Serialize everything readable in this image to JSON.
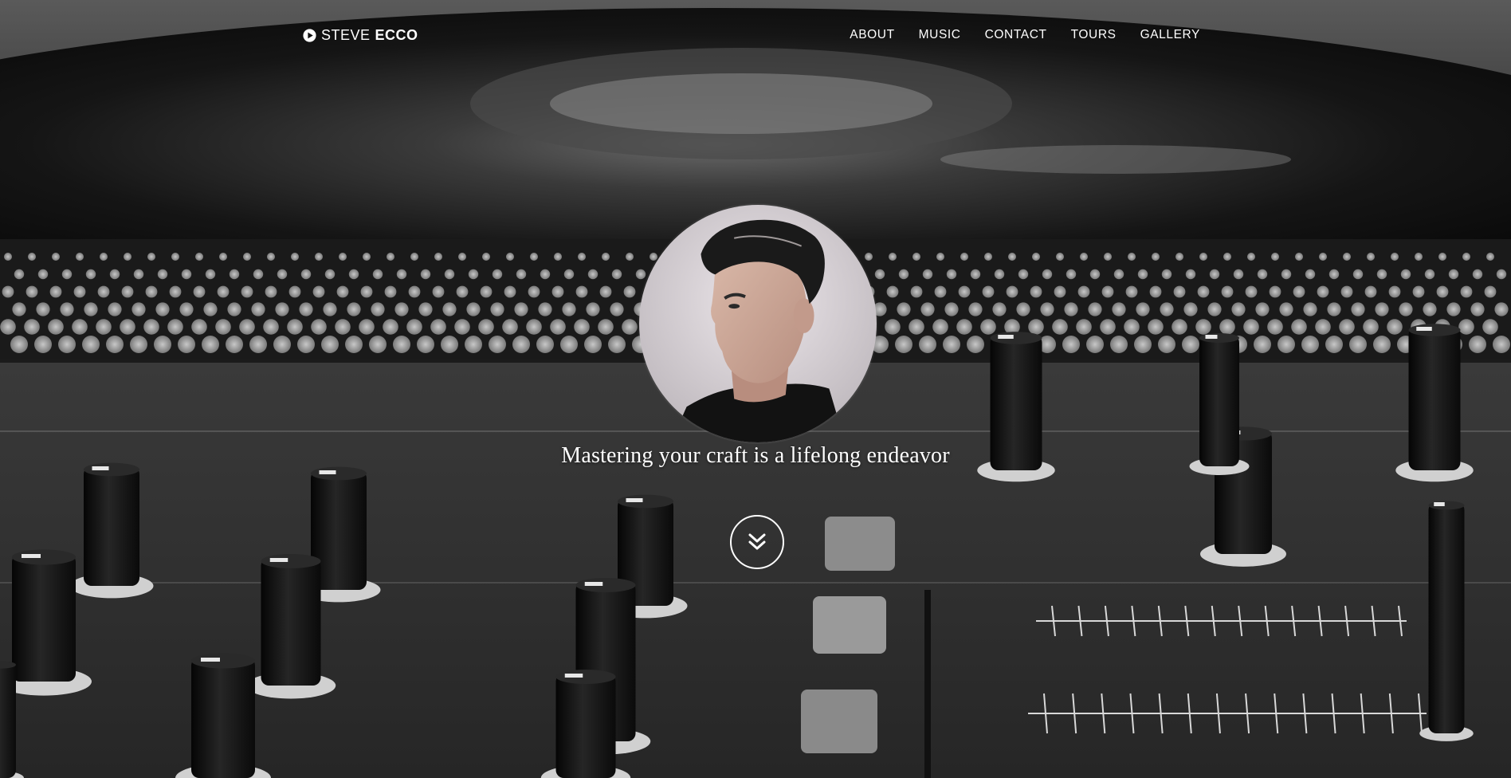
{
  "brand": {
    "first": "STEVE",
    "last": "ECCO",
    "icon": "play-circle-icon"
  },
  "nav": {
    "items": [
      {
        "label": "ABOUT"
      },
      {
        "label": "MUSIC"
      },
      {
        "label": "CONTACT"
      },
      {
        "label": "TOURS"
      },
      {
        "label": "GALLERY"
      }
    ]
  },
  "hero": {
    "tagline": "Mastering your craft is a lifelong endeavor",
    "scroll_icon": "double-chevron-down-icon",
    "avatar_alt": "profile-photo"
  },
  "colors": {
    "text": "#ffffff",
    "background": "#1a1a1a"
  }
}
